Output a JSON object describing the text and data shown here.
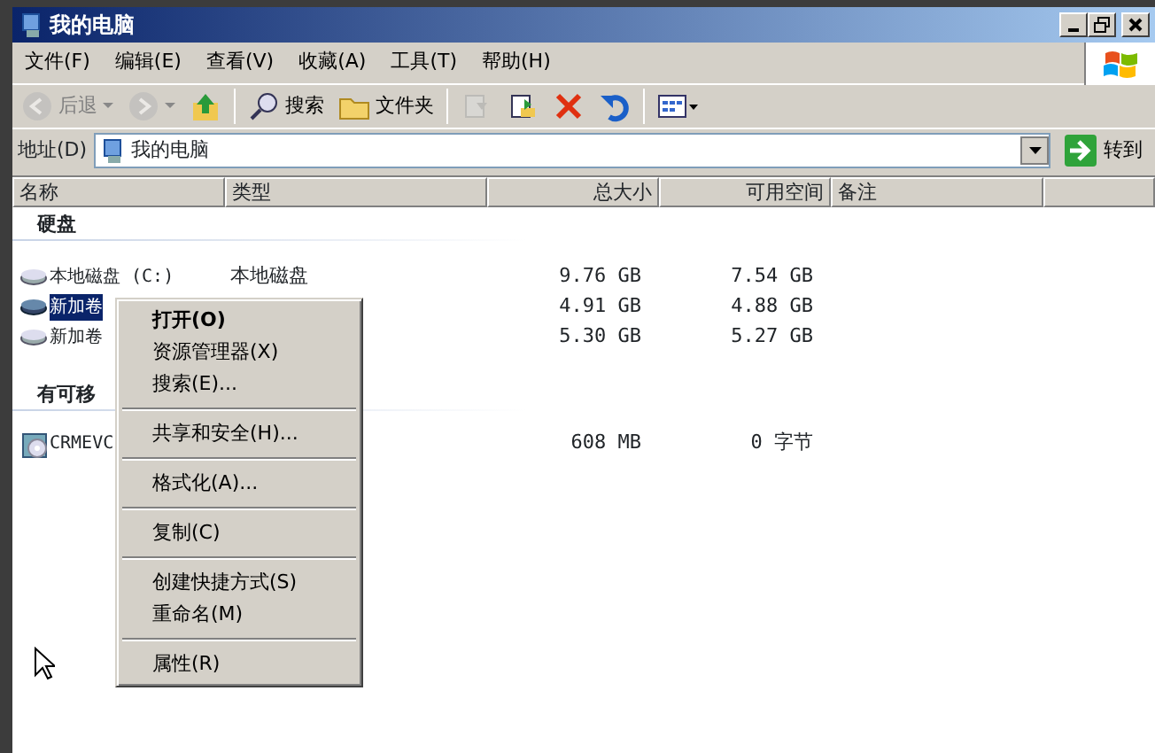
{
  "window": {
    "title": "我的电脑"
  },
  "menu_bar": [
    "文件(F)",
    "编辑(E)",
    "查看(V)",
    "收藏(A)",
    "工具(T)",
    "帮助(H)"
  ],
  "toolbar": [
    {
      "kind": "back",
      "label": "后退",
      "disabled": true
    },
    {
      "kind": "forward",
      "disabled": true
    },
    {
      "kind": "up",
      "disabled": false
    },
    {
      "kind": "search",
      "label": "搜索",
      "disabled": false
    },
    {
      "kind": "folders",
      "label": "文件夹",
      "disabled": false
    },
    {
      "kind": "move",
      "disabled": true
    },
    {
      "kind": "copy",
      "disabled": false
    },
    {
      "kind": "delete",
      "disabled": false
    },
    {
      "kind": "undo",
      "disabled": false
    },
    {
      "kind": "views",
      "disabled": false
    }
  ],
  "address": {
    "label": "地址(D)",
    "value": "我的电脑",
    "go": "转到"
  },
  "columns": [
    "名称",
    "类型",
    "总大小",
    "可用空间",
    "备注"
  ],
  "groups": [
    {
      "title": "硬盘",
      "rows": [
        {
          "name": "本地磁盘 (C:)",
          "type": "本地磁盘",
          "total": "9.76 GB",
          "free": "7.54 GB",
          "selected": false,
          "kind": "disk"
        },
        {
          "name": "新加卷",
          "total": "4.91 GB",
          "free": "4.88 GB",
          "selected": true,
          "kind": "disk"
        },
        {
          "name": "新加卷",
          "total": "5.30 GB",
          "free": "5.27 GB",
          "selected": false,
          "kind": "disk"
        }
      ]
    },
    {
      "title": "有可移",
      "rows": [
        {
          "name": "CRMEVC",
          "total": "608 MB",
          "free": "0 字节",
          "selected": false,
          "kind": "cd"
        }
      ]
    }
  ],
  "context_menu": [
    {
      "kind": "item",
      "label": "打开(O)",
      "default": true
    },
    {
      "kind": "item",
      "label": "资源管理器(X)",
      "default": false
    },
    {
      "kind": "item",
      "label": "搜索(E)...",
      "default": false
    },
    {
      "kind": "separator"
    },
    {
      "kind": "item",
      "label": "共享和安全(H)...",
      "default": false
    },
    {
      "kind": "separator"
    },
    {
      "kind": "item",
      "label": "格式化(A)...",
      "default": false
    },
    {
      "kind": "separator"
    },
    {
      "kind": "item",
      "label": "复制(C)",
      "default": false
    },
    {
      "kind": "separator"
    },
    {
      "kind": "item",
      "label": "创建快捷方式(S)",
      "default": false
    },
    {
      "kind": "item",
      "label": "重命名(M)",
      "default": false
    },
    {
      "kind": "separator"
    },
    {
      "kind": "item",
      "label": "属性(R)",
      "default": false
    }
  ]
}
